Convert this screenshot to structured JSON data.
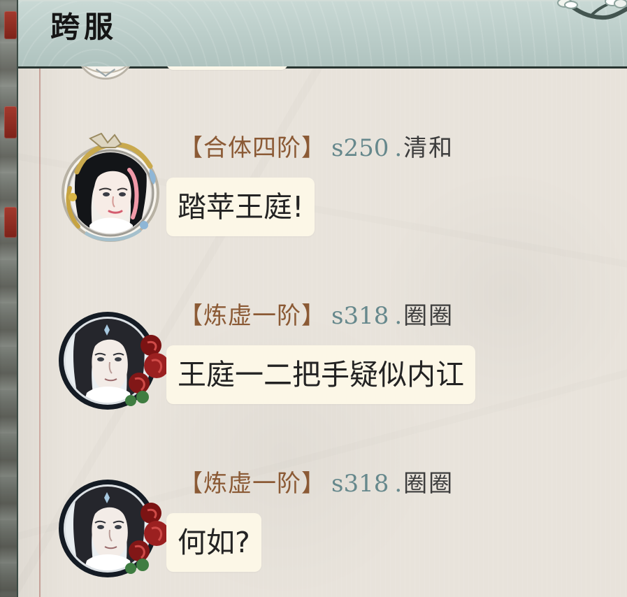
{
  "header": {
    "title": "跨服"
  },
  "messages": [
    {
      "rank": "【合体四阶】",
      "server": "s250",
      "sep": ".",
      "name": "清和",
      "text": "踏苹王庭!"
    },
    {
      "rank": "【炼虚一阶】",
      "server": "s318",
      "sep": ".",
      "name": "圈圈",
      "text": "王庭一二把手疑似内讧"
    },
    {
      "rank": "【炼虚一阶】",
      "server": "s318",
      "sep": ".",
      "name": "圈圈",
      "text": "何如?"
    }
  ],
  "icons": {
    "header_decoration": "lotus-branch-icon",
    "avatar_1": "female-avatar-icon",
    "avatar_2": "male-avatar-icon",
    "avatar_3": "male-avatar-icon"
  },
  "colors": {
    "header": "#afc3bf",
    "panel": "#e8e3db",
    "rank": "#8b5a35",
    "server": "#66888c",
    "bubble": "#fcf7e7",
    "rose": "#a3221f"
  }
}
